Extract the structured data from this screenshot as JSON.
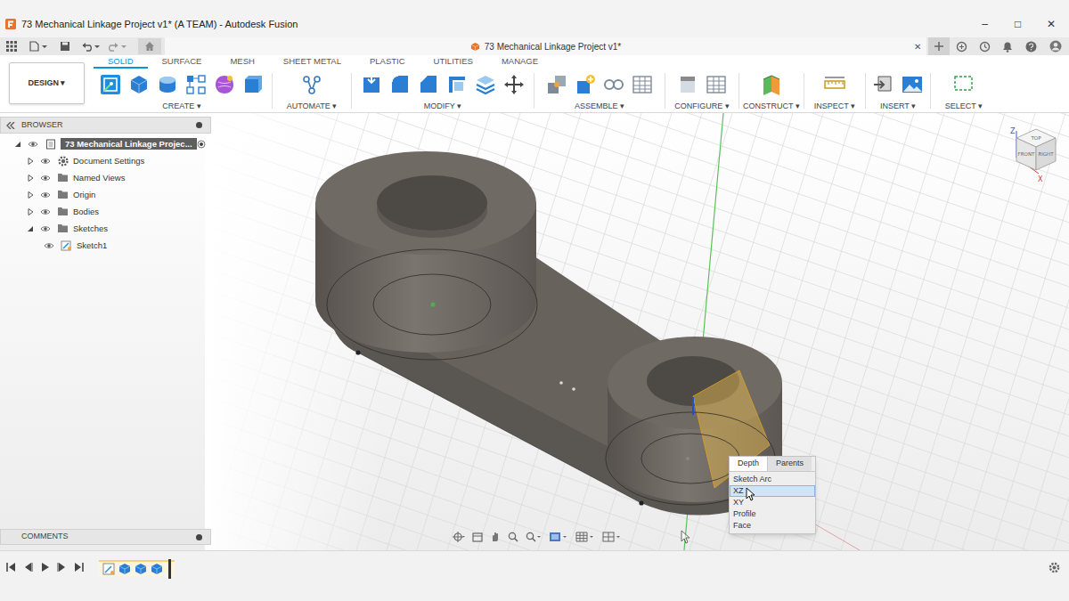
{
  "window": {
    "title": "73 Mechanical Linkage Project v1* (A TEAM) - Autodesk Fusion",
    "controls": [
      "–",
      "□",
      "✕"
    ]
  },
  "document_tab": {
    "label": "73 Mechanical Linkage Project v1*",
    "close": "✕"
  },
  "workspace": {
    "label": "DESIGN ▾"
  },
  "toolbar_tabs": [
    {
      "label": "SOLID",
      "selected": true
    },
    {
      "label": "SURFACE",
      "selected": false
    },
    {
      "label": "MESH",
      "selected": false
    },
    {
      "label": "SHEET METAL",
      "selected": false
    },
    {
      "label": "PLASTIC",
      "selected": false
    },
    {
      "label": "UTILITIES",
      "selected": false
    },
    {
      "label": "MANAGE",
      "selected": false
    }
  ],
  "toolbar_groups": [
    {
      "label": "CREATE ▾"
    },
    {
      "label": "AUTOMATE ▾"
    },
    {
      "label": "MODIFY ▾"
    },
    {
      "label": "ASSEMBLE ▾"
    },
    {
      "label": "CONFIGURE ▾"
    },
    {
      "label": "CONSTRUCT ▾"
    },
    {
      "label": "INSPECT ▾"
    },
    {
      "label": "INSERT ▾"
    },
    {
      "label": "SELECT ▾"
    }
  ],
  "browser": {
    "title": "BROWSER",
    "items": [
      {
        "label": "73 Mechanical Linkage Projec...",
        "level": 0,
        "kind": "component",
        "expanded": true,
        "selected": true
      },
      {
        "label": "Document Settings",
        "level": 1,
        "kind": "settings",
        "expanded": false,
        "selected": false
      },
      {
        "label": "Named Views",
        "level": 1,
        "kind": "folder",
        "expanded": false,
        "selected": false
      },
      {
        "label": "Origin",
        "level": 1,
        "kind": "folder",
        "expanded": false,
        "selected": false
      },
      {
        "label": "Bodies",
        "level": 1,
        "kind": "folder",
        "expanded": false,
        "selected": false
      },
      {
        "label": "Sketches",
        "level": 1,
        "kind": "folder",
        "expanded": true,
        "selected": false
      },
      {
        "label": "Sketch1",
        "level": 2,
        "kind": "sketch",
        "selected": false
      }
    ]
  },
  "comments": {
    "title": "COMMENTS"
  },
  "viewcube": {
    "faces": [
      "TOP",
      "FRONT",
      "RIGHT"
    ],
    "axes": [
      {
        "label": "Z",
        "color": "#3060d0"
      },
      {
        "label": "X",
        "color": "#d04040"
      }
    ]
  },
  "context_menu": {
    "tabs": [
      {
        "label": "Depth",
        "selected": true
      },
      {
        "label": "Parents",
        "selected": false
      }
    ],
    "items": [
      {
        "label": "Sketch Arc",
        "selected": false
      },
      {
        "label": "XZ",
        "selected": true
      },
      {
        "label": "XY",
        "selected": false
      },
      {
        "label": "Profile",
        "selected": false
      },
      {
        "label": "Face",
        "selected": false
      }
    ]
  },
  "timeline": {
    "features": [
      {
        "kind": "sketch"
      },
      {
        "kind": "extrude"
      },
      {
        "kind": "extrude"
      },
      {
        "kind": "extrude"
      }
    ]
  }
}
